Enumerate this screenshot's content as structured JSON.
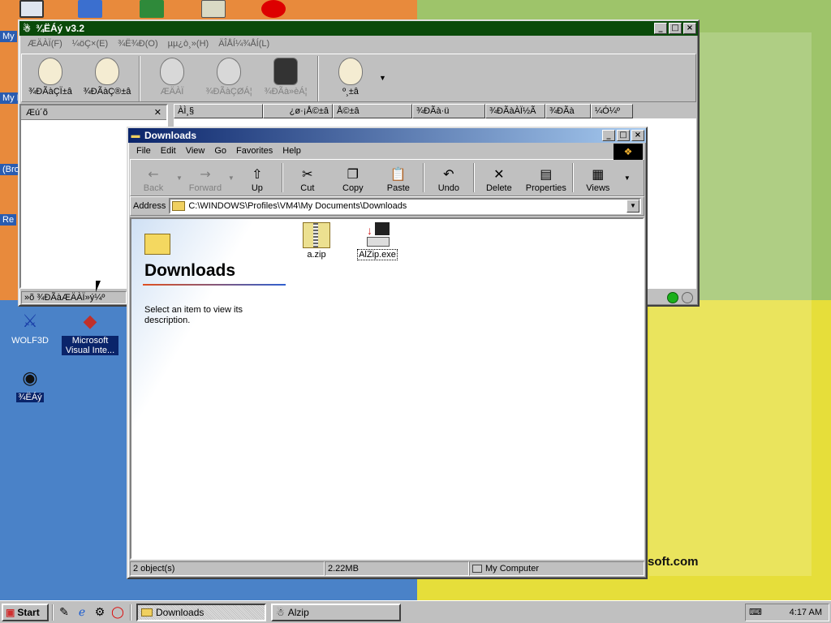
{
  "desktop": {
    "icons": [
      {
        "label": "WOLF3D",
        "icon": "wolf3d-icon"
      },
      {
        "label": "Microsoft Visual Inte...",
        "icon": "visual-interdev-icon"
      },
      {
        "label": "¾ËÁý",
        "icon": "film-reel-icon"
      }
    ],
    "edge_labels": [
      "My",
      "My D",
      "(Bro",
      "Re"
    ],
    "wallpaper_text": "soft.com"
  },
  "alzip": {
    "title": "¾ËÁý v3.2",
    "menu": [
      "ÆÄÀÏ(F)",
      "¼öÇ×(E)",
      "¾Ë¾Ð(O)",
      "µµ¿ò¸»(H)",
      "ÄÎÅÍ¼¾ÅÍ(L)"
    ],
    "tools": [
      "¾ÐÃàÇÏ±â",
      "¾ÐÃàÇ®±â",
      "ÆÄÀÏ",
      "¾ÐÃàÇØÁ¦",
      "¾ÐÃà»èÁ¦",
      "º¸±â"
    ],
    "left_panel_title": "Æú´õ",
    "columns": [
      "ÀÌ¸§",
      "¿ø·¡Å©±â",
      "Å©±â",
      "¾ÐÃà·ü",
      "¾ÐÃàÀÏ½Ã",
      "¾ÐÃà",
      "¼Ó¼º"
    ],
    "status": "»õ ¾ÐÃàÆÄÀÏ»ý¼º"
  },
  "explorer": {
    "title": "Downloads",
    "menu": [
      "File",
      "Edit",
      "View",
      "Go",
      "Favorites",
      "Help"
    ],
    "toolbar": {
      "back": "Back",
      "forward": "Forward",
      "up": "Up",
      "cut": "Cut",
      "copy": "Copy",
      "paste": "Paste",
      "undo": "Undo",
      "delete": "Delete",
      "properties": "Properties",
      "views": "Views"
    },
    "address_label": "Address",
    "address_value": "C:\\WINDOWS\\Profiles\\VM4\\My Documents\\Downloads",
    "folder_heading": "Downloads",
    "description": "Select an item to view its description.",
    "files": [
      {
        "name": "a.zip",
        "icon": "zip-folder-icon"
      },
      {
        "name": "AlZip.exe",
        "icon": "installer-icon"
      }
    ],
    "status": {
      "objects": "2 object(s)",
      "size": "2.22MB",
      "location": "My Computer"
    }
  },
  "taskbar": {
    "start": "Start",
    "tasks": [
      "Downloads",
      "Alzip"
    ],
    "clock": "4:17 AM"
  }
}
